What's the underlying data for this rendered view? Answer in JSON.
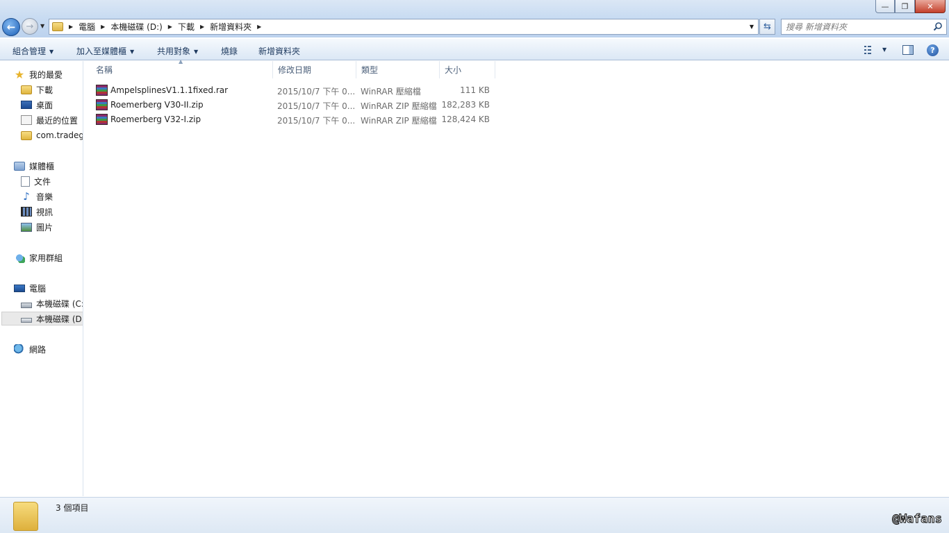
{
  "window": {
    "minimize": "—",
    "restore": "❐",
    "close": "✕"
  },
  "address": {
    "crumbs": [
      "電腦",
      "本機磁碟 (D:)",
      "下載",
      "新增資料夾"
    ]
  },
  "search": {
    "placeholder": "搜尋 新增資料夾"
  },
  "toolbar": {
    "organize": "組合管理",
    "add_to_library": "加入至媒體櫃",
    "share_with": "共用對象",
    "burn": "燒錄",
    "new_folder": "新增資料夾"
  },
  "sidebar": {
    "favorites": {
      "title": "我的最愛",
      "items": [
        "下載",
        "桌面",
        "最近的位置",
        "com.tradeg"
      ]
    },
    "libraries": {
      "title": "媒體櫃",
      "items": [
        "文件",
        "音樂",
        "視訊",
        "圖片"
      ]
    },
    "homegroup": "家用群組",
    "computer": {
      "title": "電腦",
      "items": [
        "本機磁碟 (C:)",
        "本機磁碟 (D:)"
      ]
    },
    "network": "網路"
  },
  "columns": {
    "name": "名稱",
    "date": "修改日期",
    "type": "類型",
    "size": "大小"
  },
  "files": [
    {
      "name": "AmpelsplinesV1.1.1fixed.rar",
      "date": "2015/10/7 下午 0...",
      "type": "WinRAR 壓縮檔",
      "size": "111 KB"
    },
    {
      "name": "Roemerberg V30-II.zip",
      "date": "2015/10/7 下午 0...",
      "type": "WinRAR ZIP 壓縮檔",
      "size": "182,283 KB"
    },
    {
      "name": "Roemerberg V32-I.zip",
      "date": "2015/10/7 下午 0...",
      "type": "WinRAR ZIP 壓縮檔",
      "size": "128,424 KB"
    }
  ],
  "status": {
    "count": "3 個項目"
  },
  "watermark": "@Wafans"
}
